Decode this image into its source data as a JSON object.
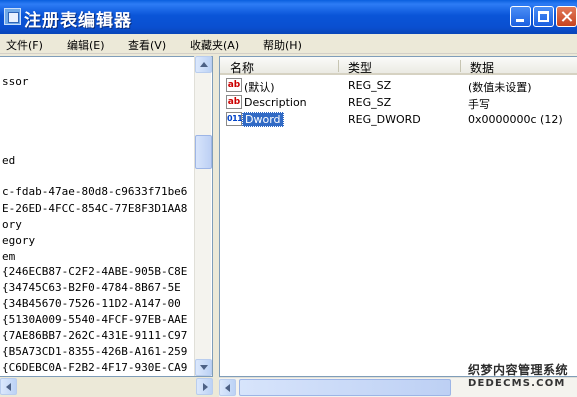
{
  "window": {
    "title": "注册表编辑器"
  },
  "menu": [
    "文件(F)",
    "编辑(E)",
    "查看(V)",
    "收藏夹(A)",
    "帮助(H)"
  ],
  "tree": {
    "lines": [
      "ssor",
      "",
      "",
      "",
      "",
      "ed",
      "",
      "c-fdab-47ae-80d8-c9633f71be6",
      "E-26ED-4FCC-854C-77E8F3D1AA8",
      "ory",
      "egory",
      "em",
      " {246ECB87-C2F2-4ABE-905B-C8E",
      " {34745C63-B2F0-4784-8B67-5E",
      " {34B45670-7526-11D2-A147-00",
      " {5130A009-5540-4FCF-97EB-AAE",
      " {7AE86BB7-262C-431E-9111-C97",
      " {B5A73CD1-8355-426B-A161-259",
      " {C6DEBC0A-F2B2-4F17-930E-CA9"
    ]
  },
  "list": {
    "columns": [
      "名称",
      "类型",
      "数据"
    ],
    "rows": [
      {
        "icon": "string-value-icon",
        "glyph": "ab",
        "name": "(默认)",
        "type": "REG_SZ",
        "data": "(数值未设置)",
        "selected": false
      },
      {
        "icon": "string-value-icon",
        "glyph": "ab",
        "name": "Description",
        "type": "REG_SZ",
        "data": "手写",
        "selected": false
      },
      {
        "icon": "binary-value-icon",
        "glyph": "011",
        "name": "Dword",
        "type": "REG_DWORD",
        "data": "0x0000000c (12)",
        "selected": true
      }
    ]
  },
  "watermark": {
    "line1": "织梦内容管理系统",
    "line2": "DEDECMS.COM"
  }
}
